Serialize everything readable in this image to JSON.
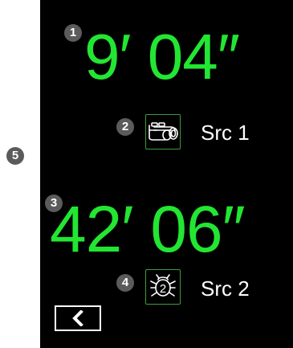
{
  "callouts": [
    "1",
    "2",
    "3",
    "4",
    "5"
  ],
  "source_1": {
    "time": "9′ 04″",
    "icon": "binoculars-icon",
    "label": "Src 1"
  },
  "source_2": {
    "time": "42′ 06″",
    "icon": "bug-2-icon",
    "icon_digit": "2",
    "label": "Src 2"
  },
  "back_button": {
    "icon": "chevron-left-icon"
  },
  "colors": {
    "time_text": "#22e632",
    "label_text": "#ffffff",
    "screen_background": "#000000",
    "icon_border": "#3c9c3c",
    "callout_background": "#5b5b5b"
  }
}
